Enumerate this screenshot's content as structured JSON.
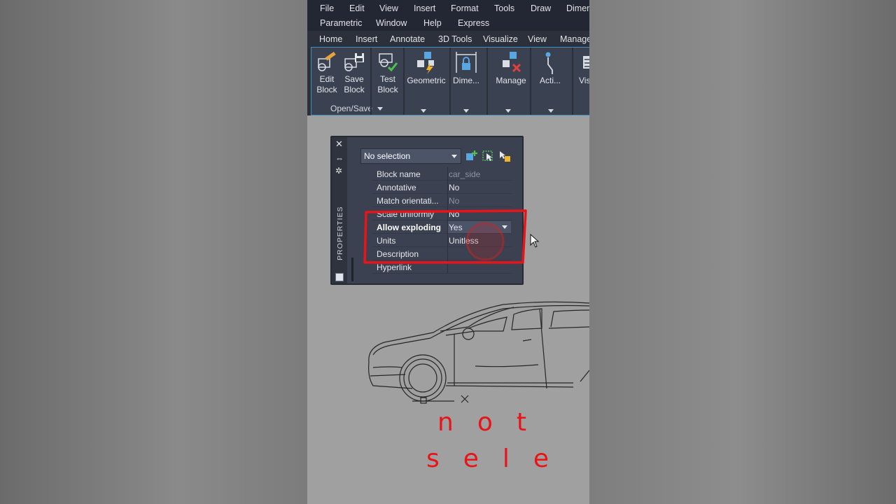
{
  "menubar": {
    "row1": [
      "File",
      "Edit",
      "View",
      "Insert",
      "Format",
      "Tools",
      "Draw",
      "Dimen"
    ],
    "row2": [
      "Parametric",
      "Window",
      "Help",
      "Express"
    ]
  },
  "ribbon_tabs": [
    "Home",
    "Insert",
    "Annotate",
    "3D Tools",
    "Visualize",
    "View",
    "Manage"
  ],
  "ribbon": {
    "open_save_panel": {
      "label": "Open/Save",
      "edit_block": {
        "line1": "Edit",
        "line2": "Block"
      },
      "save_block": {
        "line1": "Save",
        "line2": "Block"
      }
    },
    "test_block": {
      "line1": "Test",
      "line2": "Block"
    },
    "geometric": "Geometric",
    "dimensional": "Dime...",
    "manage": "Manage",
    "actions": "Acti...",
    "visibility": "Vis"
  },
  "properties": {
    "palette_label": "PROPERTIES",
    "selection": "No selection",
    "rows": [
      {
        "name": "Block name",
        "value": "car_side"
      },
      {
        "name": "Annotative",
        "value": "No"
      },
      {
        "name": "Match orientati...",
        "value": "No"
      },
      {
        "name": "Scale uniformly",
        "value": "No"
      },
      {
        "name": "Allow exploding",
        "value": "Yes"
      },
      {
        "name": "Units",
        "value": "Unitless"
      },
      {
        "name": "Description",
        "value": ""
      },
      {
        "name": "Hyperlink",
        "value": ""
      }
    ]
  },
  "overlay": {
    "line1": "not",
    "line2": "sele"
  },
  "colors": {
    "highlight_red": "#e8141a",
    "accent_blue": "#3f8fc6"
  }
}
